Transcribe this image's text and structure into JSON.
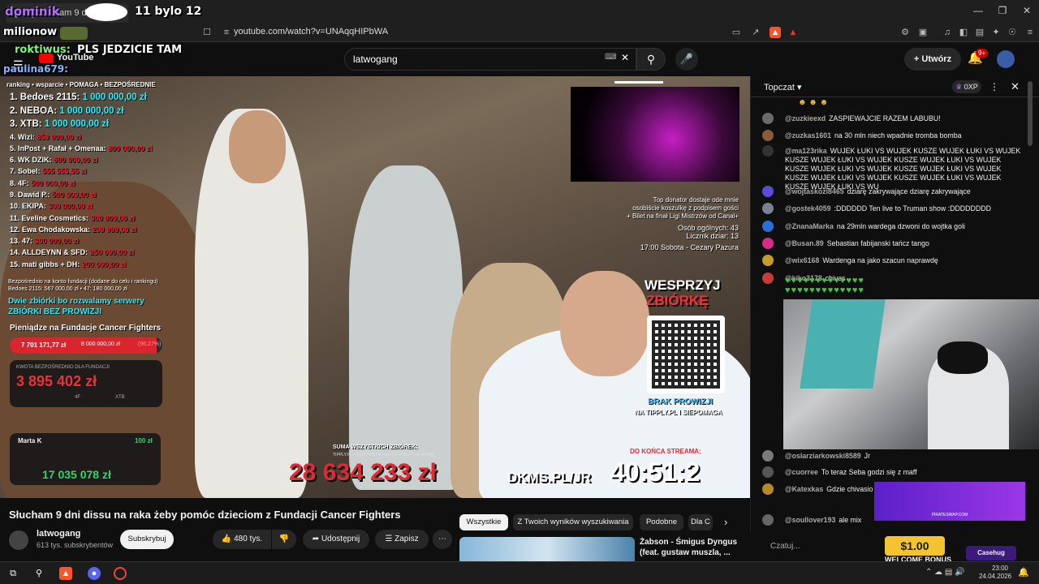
{
  "browser": {
    "tab_title": "[125] Słucham 9 dni dissu",
    "url": "youtube.com/watch?v=UNAqqHIPbWA",
    "overlay_top_left": "dominik",
    "overlay_top_mid": "11 bylo 12",
    "overlay_milionow": "milionow",
    "overlay_roktiwus": "roktiwus:",
    "overlay_pls": "PLS JEDZICIE TAM",
    "overlay_paulina": "paulina679:",
    "overlay_youtube": "YouTube"
  },
  "header": {
    "search_value": "latwogang",
    "create_label": "Utwórz",
    "notif_badge": "9+"
  },
  "video": {
    "ranking_header": "ranking • wsparcie • POMAGA • BEZPOŚREDNIE",
    "ranking": [
      {
        "label": "1. Bedoes 2115:",
        "amount": "1 000 000,00 zł",
        "color": "cyan"
      },
      {
        "label": "2. NEBOA:",
        "amount": "1 000 000,00 zł",
        "color": "cyan"
      },
      {
        "label": "3. XTB:",
        "amount": "1 000 000,00 zł",
        "color": "cyan"
      },
      {
        "label": "4. Wizi:",
        "amount": "850 000,00 zł",
        "color": "red"
      },
      {
        "label": "5. InPost + Rafał + Omenaa:",
        "amount": "800 000,00 zł",
        "color": "red"
      },
      {
        "label": "6. WK DZIK:",
        "amount": "600 000,00 zł",
        "color": "red"
      },
      {
        "label": "7. Sobel:",
        "amount": "555 555,55 zł",
        "color": "red"
      },
      {
        "label": "8. 4F:",
        "amount": "500 000,00 zł",
        "color": "red"
      },
      {
        "label": "9. Dawid P.:",
        "amount": "500 000,00 zł",
        "color": "red"
      },
      {
        "label": "10. EKIPA:",
        "amount": "300 000,00 zł",
        "color": "red"
      },
      {
        "label": "11. Eveline Cosmetics:",
        "amount": "300 000,00 zł",
        "color": "red"
      },
      {
        "label": "12. Ewa Chodakowska:",
        "amount": "299 999,00 zł",
        "color": "red"
      },
      {
        "label": "13. 47:",
        "amount": "300 000,00 zł",
        "color": "red"
      },
      {
        "label": "14. ALLDEYNN & SFD:",
        "amount": "250 000,00 zł",
        "color": "red"
      },
      {
        "label": "15. mati gibbs + DH:",
        "amount": "200 000,00 zł",
        "color": "red"
      }
    ],
    "direct_note": "Bezpośrednio na konto fundacji (dodane do celu i rankingu)",
    "direct_line": "Bedoes 2115: 567 000,00 zł • 47: 180 000,00 zł",
    "collections_line1": "Dwie zbiórki bo rozwalamy serwery",
    "collections_line2": "ZBIÓRKI BEZ PROWIZJI",
    "foundation_label": "Pieniądze na Fundacje Cancer Fighters",
    "progress_left": "7 701 171,77 zł",
    "progress_right": "8 000 000,00 zł",
    "progress_pct": "(96.27%)",
    "progress_fraction": 0.9627,
    "direct_small": "KWOTA BEZPOŚREDNIO DLA FUNDACJI",
    "direct_amount": "3 895 402 zł",
    "sub_a": "4F",
    "sub_b": "XTB",
    "donor_name": "Marta K",
    "donor_amount": "100 zł",
    "total_amount": "17 035 078 zł",
    "cam_caption_1": "Top donator dostaje ode mnie",
    "cam_caption_2": "osobiście koszulkę z podpisem gości",
    "cam_caption_3": "+ Bilet na finał Ligi Mistrzów od Canal+",
    "count_total": "Osób ogólnych: 43",
    "count_licznik": "Licznik dziar: 13",
    "schedule": "17:00 Sobota - Cezary Pazura",
    "support_1": "WESPRZYJ",
    "support_2": "ZBIÓRKĘ",
    "no_fee": "BRAK PROWIZJI",
    "no_fee_sub": "NA TIPPLY.PL I SIEPOMAGA",
    "sum_label": "SUMA WSZYSTKICH ZBIÓREK:",
    "sum_sub": "TIPPLY.PL + SIEPOMAGA + WPŁATY BEZPOŚREDNIE",
    "sum_amount": "28 634 233 zł",
    "dkms": "DKMS.PL/JR",
    "timer_label": "DO KOŃCA STREAMA:",
    "timer": "40:51:2"
  },
  "below": {
    "title": "Słucham 9 dni dissu na raka żeby pomóc dzieciom z Fundacji Cancer Fighters",
    "channel": "latwogang",
    "subs": "613 tys. subskrybentów",
    "subscribe": "Subskrybuj",
    "likes": "480 tys.",
    "share": "Udostępnij",
    "save": "Zapisz"
  },
  "chips": [
    "Wszystkie",
    "Z Twoich wyników wyszukiwania",
    "Podobne",
    "Dla C"
  ],
  "recommended": {
    "title": "Żabson - Śmigus Dyngus",
    "subtitle": "(feat. gustaw muszla, ..."
  },
  "chat": {
    "header": "Topczat",
    "pill": "0XP",
    "messages": [
      {
        "author": "@zuzkieexd",
        "text": "ZASPIEWAJCIE RAZEM LABUBU!",
        "color": "#6b6b6b"
      },
      {
        "author": "@zuzkas1601",
        "text": "na 30 mln niech wpadnie tromba bomba",
        "color": "#8a5a3a"
      },
      {
        "author": "@ma123rika",
        "text": "WUJEK ŁUKI VS WUJEK KUSZE WUJEK ŁUKI VS WUJEK KUSZE WUJEK ŁUKI VS WUJEK KUSZE WUJEK ŁUKI VS WUJEK KUSZE WUJEK ŁUKI VS WUJEK KUSZE WUJEK ŁUKI VS WUJEK KUSZE WUJEK ŁUKI VS WUJEK KUSZE WUJEK ŁUKI VS WUJEK KUSZE WUJEK ŁUKI VS WU",
        "color": "#333"
      },
      {
        "author": "@wojtaskozi8465",
        "text": "dziarę zakrywające dziarę zakrywające",
        "color": "#5b4bd6"
      },
      {
        "author": "@gostek4059",
        "text": ":DDDDDD Ten live to Truman show :DDDDDDDD",
        "color": "#7a8290"
      },
      {
        "author": "@ZnanaMarka",
        "text": "na 29mln wardega dzwoni do wojtka goli",
        "color": "#2b6fd6"
      },
      {
        "author": "@Busan.89",
        "text": "Sebastian fabijanski tańcz tango",
        "color": "#d62b8a"
      },
      {
        "author": "@wix6168",
        "text": "Wardenga na jako szacun naprawdę",
        "color": "#c79a2b"
      },
      {
        "author": "@kiko3178",
        "text": "chivas",
        "color": "#c73b3b"
      },
      {
        "author": "@oslarziarkowski8589",
        "text": "Jr",
        "color": "#7a7a7a"
      },
      {
        "author": "@cuorree",
        "text": "To teraz Seba godzi się z maff",
        "color": "#555"
      },
      {
        "author": "@Katexkas",
        "text": "Gdzie chivasio",
        "color": "#b8882b"
      },
      {
        "author": "@soullover193",
        "text": "ale mix",
        "color": "#666"
      }
    ],
    "input_placeholder": "Czatuj...",
    "ad_price": "$1.00",
    "ad_text": "WELCOME BONUS",
    "ad_brand": "Casehug",
    "ad_banner": "PIRATESWAP.COM"
  },
  "taskbar": {
    "time": "23:00",
    "date": "24.04.2026"
  }
}
